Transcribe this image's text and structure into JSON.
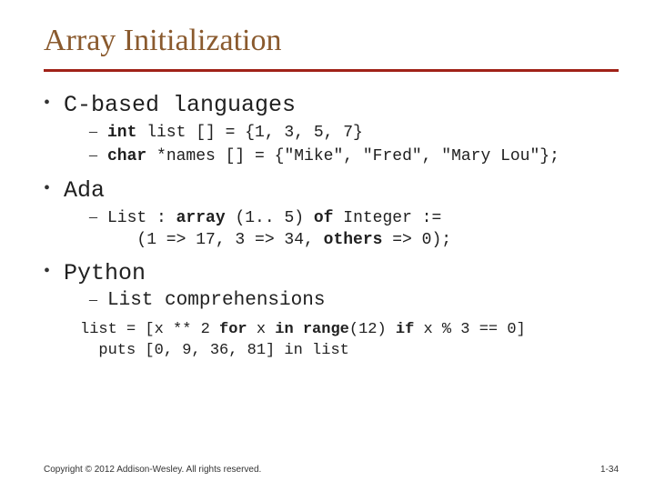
{
  "title": "Array Initialization",
  "sections": [
    {
      "heading": "C-based languages",
      "items": [
        {
          "kind": "code",
          "html": "<b>int</b> list [] = {1, 3, 5, 7}"
        },
        {
          "kind": "code",
          "html": "<b>char</b> *names [] = {″Mike″, ″Fred″, ″Mary Lou″};"
        }
      ]
    },
    {
      "heading": "Ada",
      "items": [
        {
          "kind": "code",
          "html": "List : <b>array</b> (1.. 5) <b>of</b> Integer := \n   (1 => 17, 3 => 34, <b>others</b> => 0);"
        }
      ]
    },
    {
      "heading": "Python",
      "items": [
        {
          "kind": "subhead",
          "text": "List comprehensions"
        }
      ],
      "extra": [
        {
          "kind": "code-sm",
          "html": "list = [x ** 2 <b>for</b> x <b>in</b> <b>range</b>(12) <b>if</b> x % 3 == 0]"
        },
        {
          "kind": "code-sm",
          "html": "  puts [0, 9, 36, 81] in list"
        }
      ]
    }
  ],
  "footer": {
    "copyright": "Copyright © 2012 Addison-Wesley. All rights reserved.",
    "page": "1-34"
  }
}
